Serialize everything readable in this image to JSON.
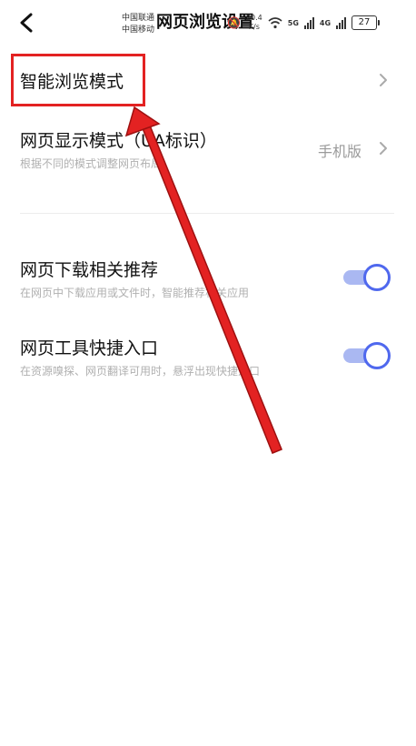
{
  "status_bar": {
    "carrier1": "中国联通",
    "carrier2": "中国移动",
    "speed_value": "20.4",
    "speed_unit": "K/s",
    "net1": "5G",
    "net2": "4G",
    "battery": "27"
  },
  "header": {
    "title": "网页浏览设置"
  },
  "settings": {
    "smart_mode": {
      "title": "智能浏览模式"
    },
    "display_mode": {
      "title": "网页显示模式（UA标识）",
      "subtitle": "根据不同的模式调整网页布局",
      "value": "手机版"
    },
    "download_rec": {
      "title": "网页下载相关推荐",
      "subtitle": "在网页中下载应用或文件时，智能推荐相关应用",
      "on": true
    },
    "tools_entry": {
      "title": "网页工具快捷入口",
      "subtitle": "在资源嗅探、网页翻译可用时，悬浮出现快捷入口",
      "on": true
    }
  },
  "colors": {
    "toggle_on": "#4f68ee",
    "toggle_track": "#aab8f2",
    "annotation": "#e32222"
  }
}
